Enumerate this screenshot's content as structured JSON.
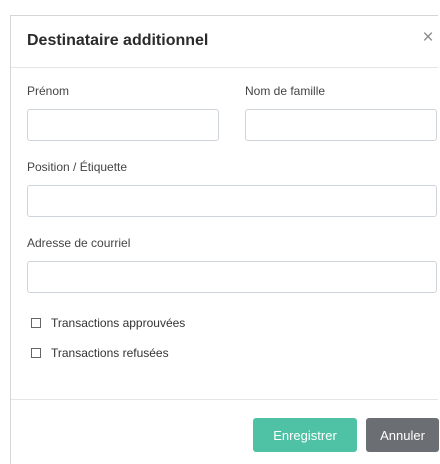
{
  "dialog": {
    "title": "Destinataire additionnel",
    "close_glyph": "×"
  },
  "form": {
    "first_name": {
      "label": "Prénom",
      "value": "",
      "placeholder": ""
    },
    "last_name": {
      "label": "Nom de famille",
      "value": "",
      "placeholder": ""
    },
    "position": {
      "label": "Position / Étiquette",
      "value": "",
      "placeholder": ""
    },
    "email": {
      "label": "Adresse de courriel",
      "value": "",
      "placeholder": ""
    },
    "checkboxes": [
      {
        "label": "Transactions approuvées",
        "checked": false
      },
      {
        "label": "Transactions refusées",
        "checked": false
      }
    ]
  },
  "footer": {
    "save_label": "Enregistrer",
    "cancel_label": "Annuler"
  },
  "colors": {
    "save_button": "#4fc2a6",
    "cancel_button": "#6b6e73"
  }
}
